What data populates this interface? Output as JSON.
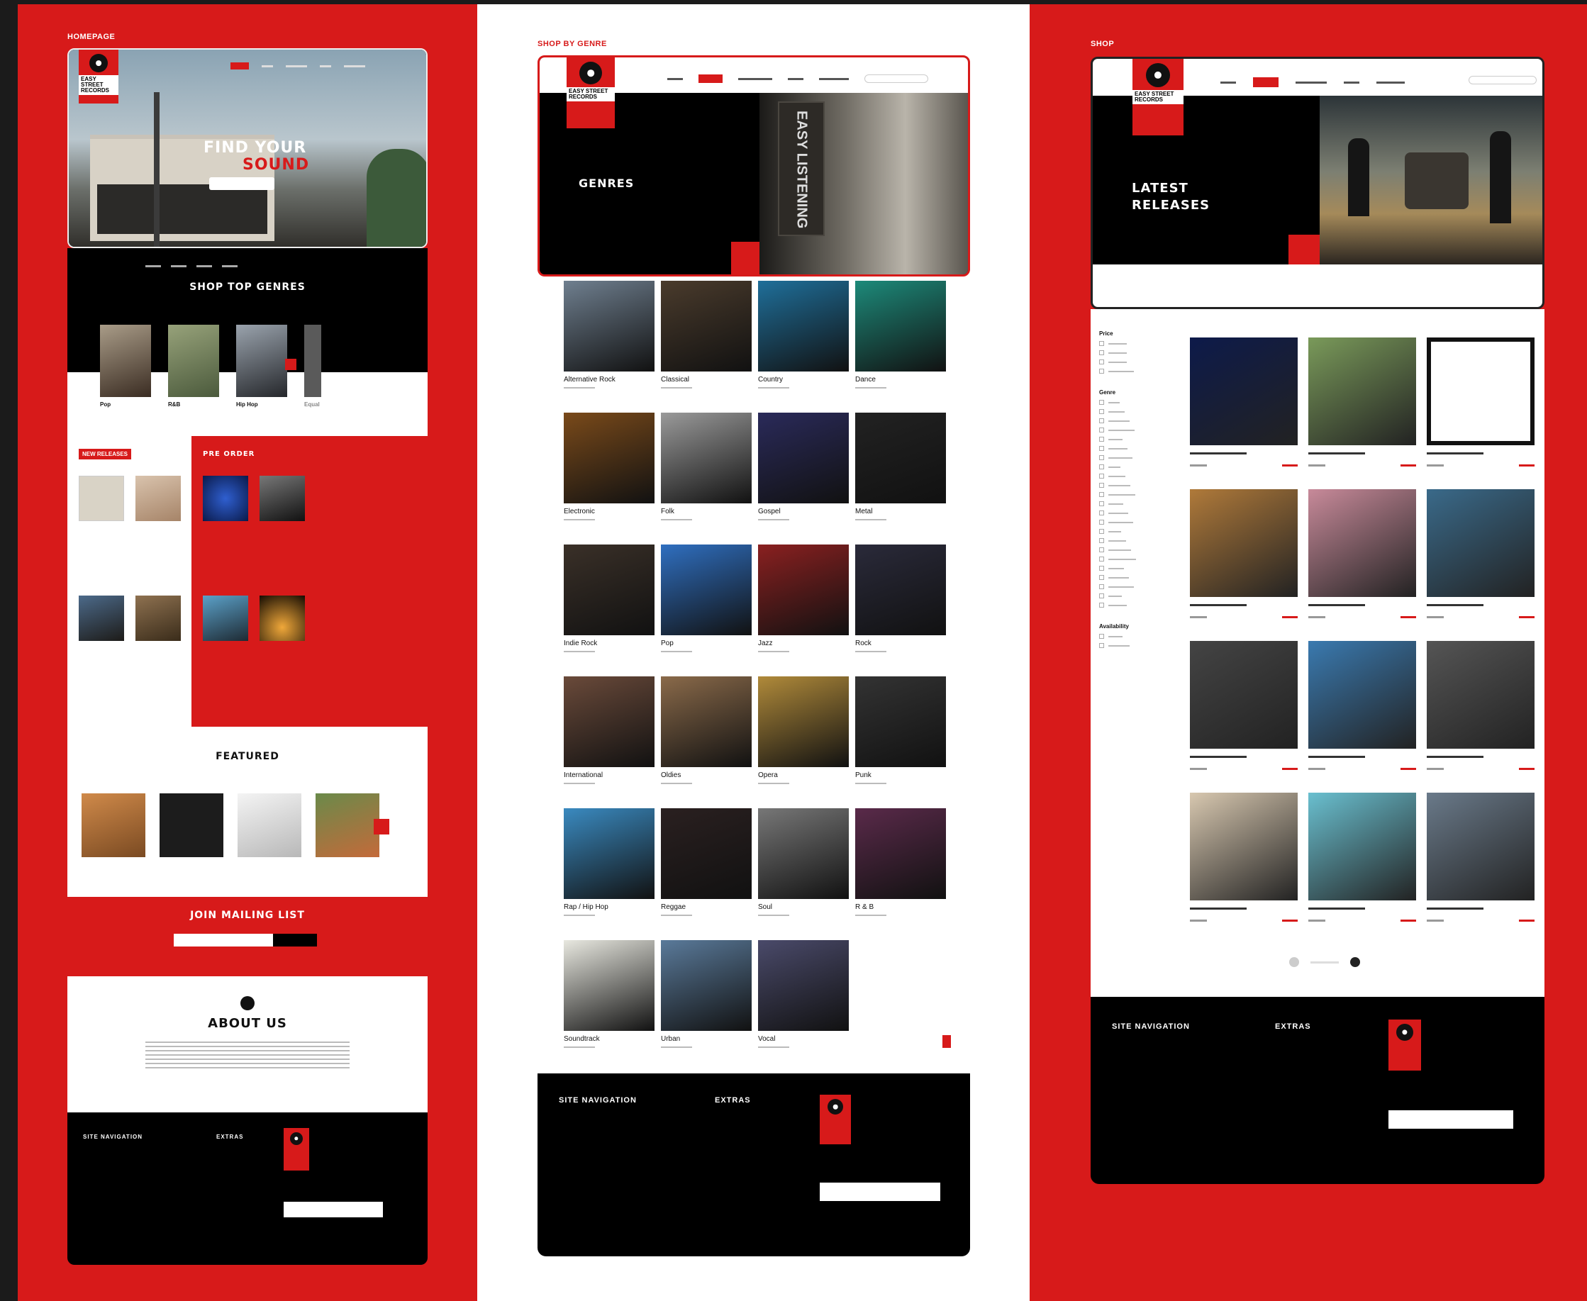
{
  "panels": {
    "homepage_caption": "HOMEPAGE",
    "genre_caption": "SHOP BY GENRE",
    "shop_caption": "SHOP"
  },
  "brand": {
    "logo_text": "EASY STREET RECORDS",
    "accent": "#d71a1a",
    "dark": "#000000"
  },
  "home": {
    "hero_title_1": "FIND YOUR",
    "hero_title_2": "SOUND",
    "top_genres_title": "SHOP TOP GENRES",
    "genres": [
      "Pop",
      "R&B",
      "Hip Hop",
      "Equal"
    ],
    "new_releases_badge": "NEW RELEASES",
    "pre_order_title": "PRE ORDER",
    "featured_title": "FEATURED",
    "mailing_title": "JOIN MAILING LIST",
    "about_title": "ABOUT US",
    "footer_nav_title": "SITE NAVIGATION",
    "footer_extras_title": "EXTRAS"
  },
  "genre_page": {
    "hero_title": "GENRES",
    "hero_sign": "EASY LISTENING",
    "genres": [
      "Alternative Rock",
      "Classical",
      "Country",
      "Dance",
      "Electronic",
      "Folk",
      "Gospel",
      "Metal",
      "Indie Rock",
      "Pop",
      "Jazz",
      "Rock",
      "International",
      "Oldies",
      "Opera",
      "Punk",
      "Rap / Hip Hop",
      "Reggae",
      "Soul",
      "R & B",
      "Soundtrack",
      "Urban",
      "Vocal"
    ],
    "footer_nav_title": "SITE NAVIGATION",
    "footer_extras_title": "EXTRAS"
  },
  "shop_page": {
    "hero_title_1": "LATEST",
    "hero_title_2": "RELEASES",
    "filter_groups": [
      "Price",
      "Genre",
      "Availability"
    ],
    "footer_nav_title": "SITE NAVIGATION",
    "footer_extras_title": "EXTRAS"
  }
}
